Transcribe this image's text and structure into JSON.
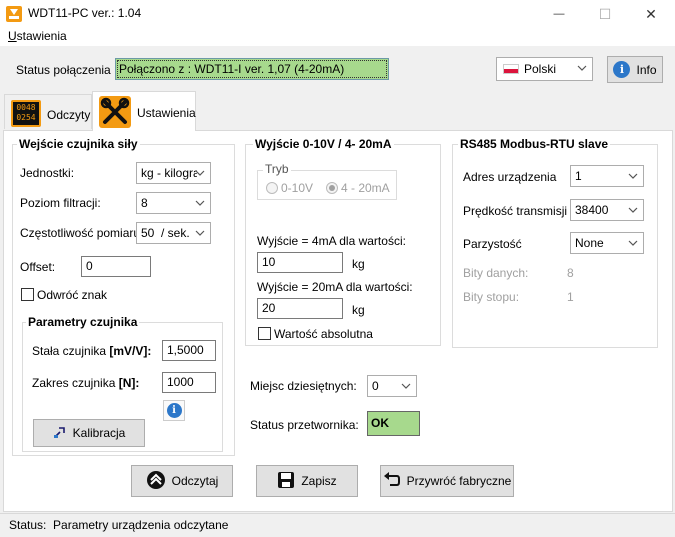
{
  "window": {
    "title": "WDT11-PC  ver.: 1.04",
    "minimize": "—",
    "maximize": "☐",
    "close": "✕"
  },
  "menu": {
    "settings_first": "U",
    "settings_rest": "stawienia"
  },
  "connection": {
    "label": "Status połączenia",
    "value": "Połączono z : WDT11-I ver. 1,07 (4-20mA)",
    "language": "Polski",
    "info_label": "Info"
  },
  "tabs": {
    "readings": "Odczyty",
    "settings": "Ustawienia",
    "lcd_top": "0048",
    "lcd_bottom": "0254"
  },
  "sensor_input": {
    "title": "Wejście czujnika siły",
    "units_label": "Jednostki:",
    "units_value": "kg - kilogra",
    "filter_label": "Poziom filtracji:",
    "filter_value": "8",
    "freq_label": "Częstotliwość pomiaru:",
    "freq_value": "50  / sek.",
    "offset_label": "Offset:",
    "offset_value": "0",
    "invert_label": "Odwróć znak",
    "params": {
      "title": "Parametry czujnika",
      "const_label": "Stała czujnika ",
      "const_unit": "[mV/V]:",
      "const_value": "1,5000",
      "range_label": "Zakres czujnika ",
      "range_unit": "[N]:",
      "range_value": "1000",
      "calibrate_label": "Kalibracja"
    }
  },
  "analog_output": {
    "title": "Wyjście 0-10V / 4- 20mA",
    "mode_label": "Tryb",
    "mode_opt1": "0-10V",
    "mode_opt2": "4 - 20mA",
    "out4_label": "Wyjście = 4mA dla wartości:",
    "out4_value": "10",
    "out4_unit": "kg",
    "out20_label": "Wyjście = 20mA dla wartości:",
    "out20_value": "20",
    "out20_unit": "kg",
    "absolute_label": "Wartość absolutna"
  },
  "modbus": {
    "title": "RS485 Modbus-RTU slave",
    "address_label": "Adres urządzenia",
    "address_value": "1",
    "baud_label": "Prędkość transmisji",
    "baud_value": "38400",
    "parity_label": "Parzystość",
    "parity_value": "None",
    "databits_label": "Bity danych:",
    "databits_value": "8",
    "stopbits_label": "Bity stopu:",
    "stopbits_value": "1"
  },
  "decimals": {
    "label": "Miejsc dziesiętnych:",
    "value": "0"
  },
  "converter": {
    "label": "Status przetwornika:",
    "value": "OK"
  },
  "actions": {
    "read": "Odczytaj",
    "save": "Zapisz",
    "restore": "Przywróć fabryczne"
  },
  "statusbar": {
    "text": "Status:  Parametry urządzenia odczytane"
  },
  "colors": {
    "ok_green": "#a7d98d",
    "tab_icon_orange": "#f39a12",
    "info_blue": "#2c77c9"
  }
}
